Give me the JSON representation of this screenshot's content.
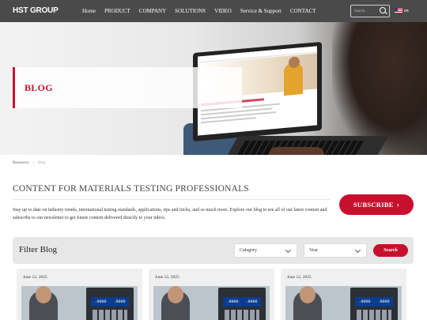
{
  "nav": {
    "logo": "HST GROUP",
    "items": [
      "Home",
      "PRODUCT",
      "COMPANY",
      "SOLUTIONS",
      "VIDEO",
      "Service & Support",
      "CONTACT"
    ],
    "search_placeholder": "Search",
    "language": "en"
  },
  "hero": {
    "title": "BLOG"
  },
  "breadcrumb": {
    "items": [
      "Resources",
      "Blog"
    ],
    "separator": ">"
  },
  "intro": {
    "title": "CONTENT FOR MATERIALS TESTING PROFESSIONALS",
    "text": "Stay up to date on industry trends, international testing standards, applications, tips and tricks, and so much more. Explore our blog to see all of our latest content and subscribe to our newsletter to get future content delivered directly to your inbox.",
    "subscribe_label": "SUBSCRIBE"
  },
  "filter": {
    "title": "Filter Blog",
    "category_label": "Category",
    "year_label": "Year",
    "search_label": "Search"
  },
  "cards": [
    {
      "date": "June 12, 2025",
      "readout": ".0000"
    },
    {
      "date": "June 12, 2025",
      "readout": ".0000"
    },
    {
      "date": "June 12, 2025",
      "readout": ".0000"
    }
  ],
  "colors": {
    "accent": "#c8102e",
    "nav_bg": "#4a4a4a",
    "filter_bg": "#e7e7e7"
  }
}
